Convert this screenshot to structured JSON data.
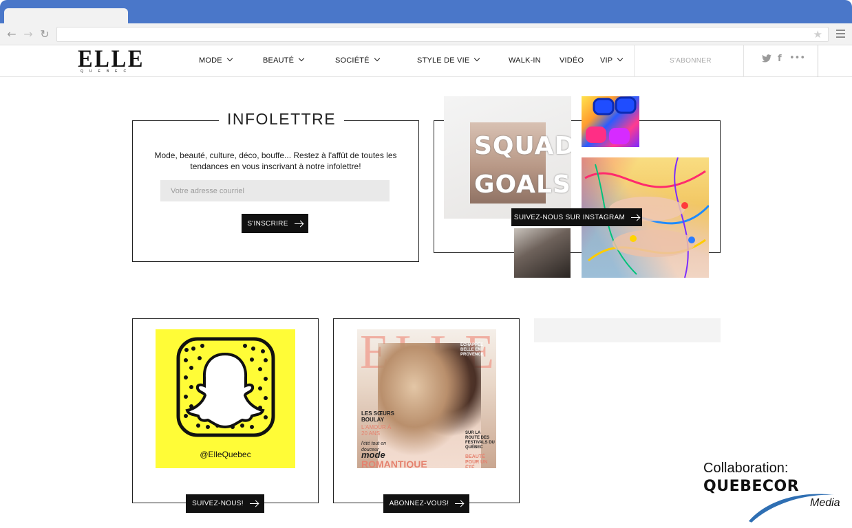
{
  "site": {
    "logo_text": "ELLE",
    "logo_sub": "QUÉBEC",
    "nav": [
      {
        "label": "MODE",
        "dropdown": true
      },
      {
        "label": "BEAUTÉ",
        "dropdown": true
      },
      {
        "label": "SOCIÉTÉ",
        "dropdown": true
      },
      {
        "label": "STYLE DE VIE",
        "dropdown": true
      },
      {
        "label": "WALK-IN",
        "dropdown": false
      },
      {
        "label": "VIDÉO",
        "dropdown": false
      },
      {
        "label": "VIP",
        "dropdown": true
      }
    ],
    "subscribe_label": "S'ABONNER",
    "social_icons": [
      "twitter-icon",
      "facebook-icon",
      "more-icon"
    ]
  },
  "newsletter": {
    "title": "INFOLETTRE",
    "text": "Mode, beauté, culture, déco, bouffe... Restez à l'affût de toutes les tendances en vous inscrivant à notre infolettre!",
    "email_placeholder": "Votre adresse courriel",
    "submit_label": "S'INSCRIRE"
  },
  "instagram": {
    "button_label": "SUIVEZ-NOUS SUR INSTAGRAM",
    "shirt_text_line1": "SQUAD",
    "shirt_text_line2": "GOALS"
  },
  "snapchat": {
    "handle": "@ElleQuebec",
    "button_label": "SUIVEZ-NOUS!"
  },
  "magazine": {
    "button_label": "ABONNEZ-VOUS!",
    "cover_logo": "ELLE",
    "cover_lines": {
      "top_right": "ÉCHAPPÉE BELLE EN PROVENCE",
      "headline": "LES SŒURS BOULAY",
      "subhead": "L'AMOUR À 20 ANS",
      "script": "l'été tout en douceur",
      "mode": "mode",
      "romantique": "ROMANTIQUE",
      "festivals": "SUR LA ROUTE DES FESTIVALS DU QUÉBEC",
      "beaute": "BEAUTÉ POUR UN ÉTÉ"
    }
  },
  "collaboration": {
    "label": "Collaboration:",
    "brand": "QUEBECOR",
    "brand_sub": "Media"
  },
  "colors": {
    "chrome_blue": "#4a77c9",
    "snap_yellow": "#fffc37",
    "button_black": "#111111"
  }
}
